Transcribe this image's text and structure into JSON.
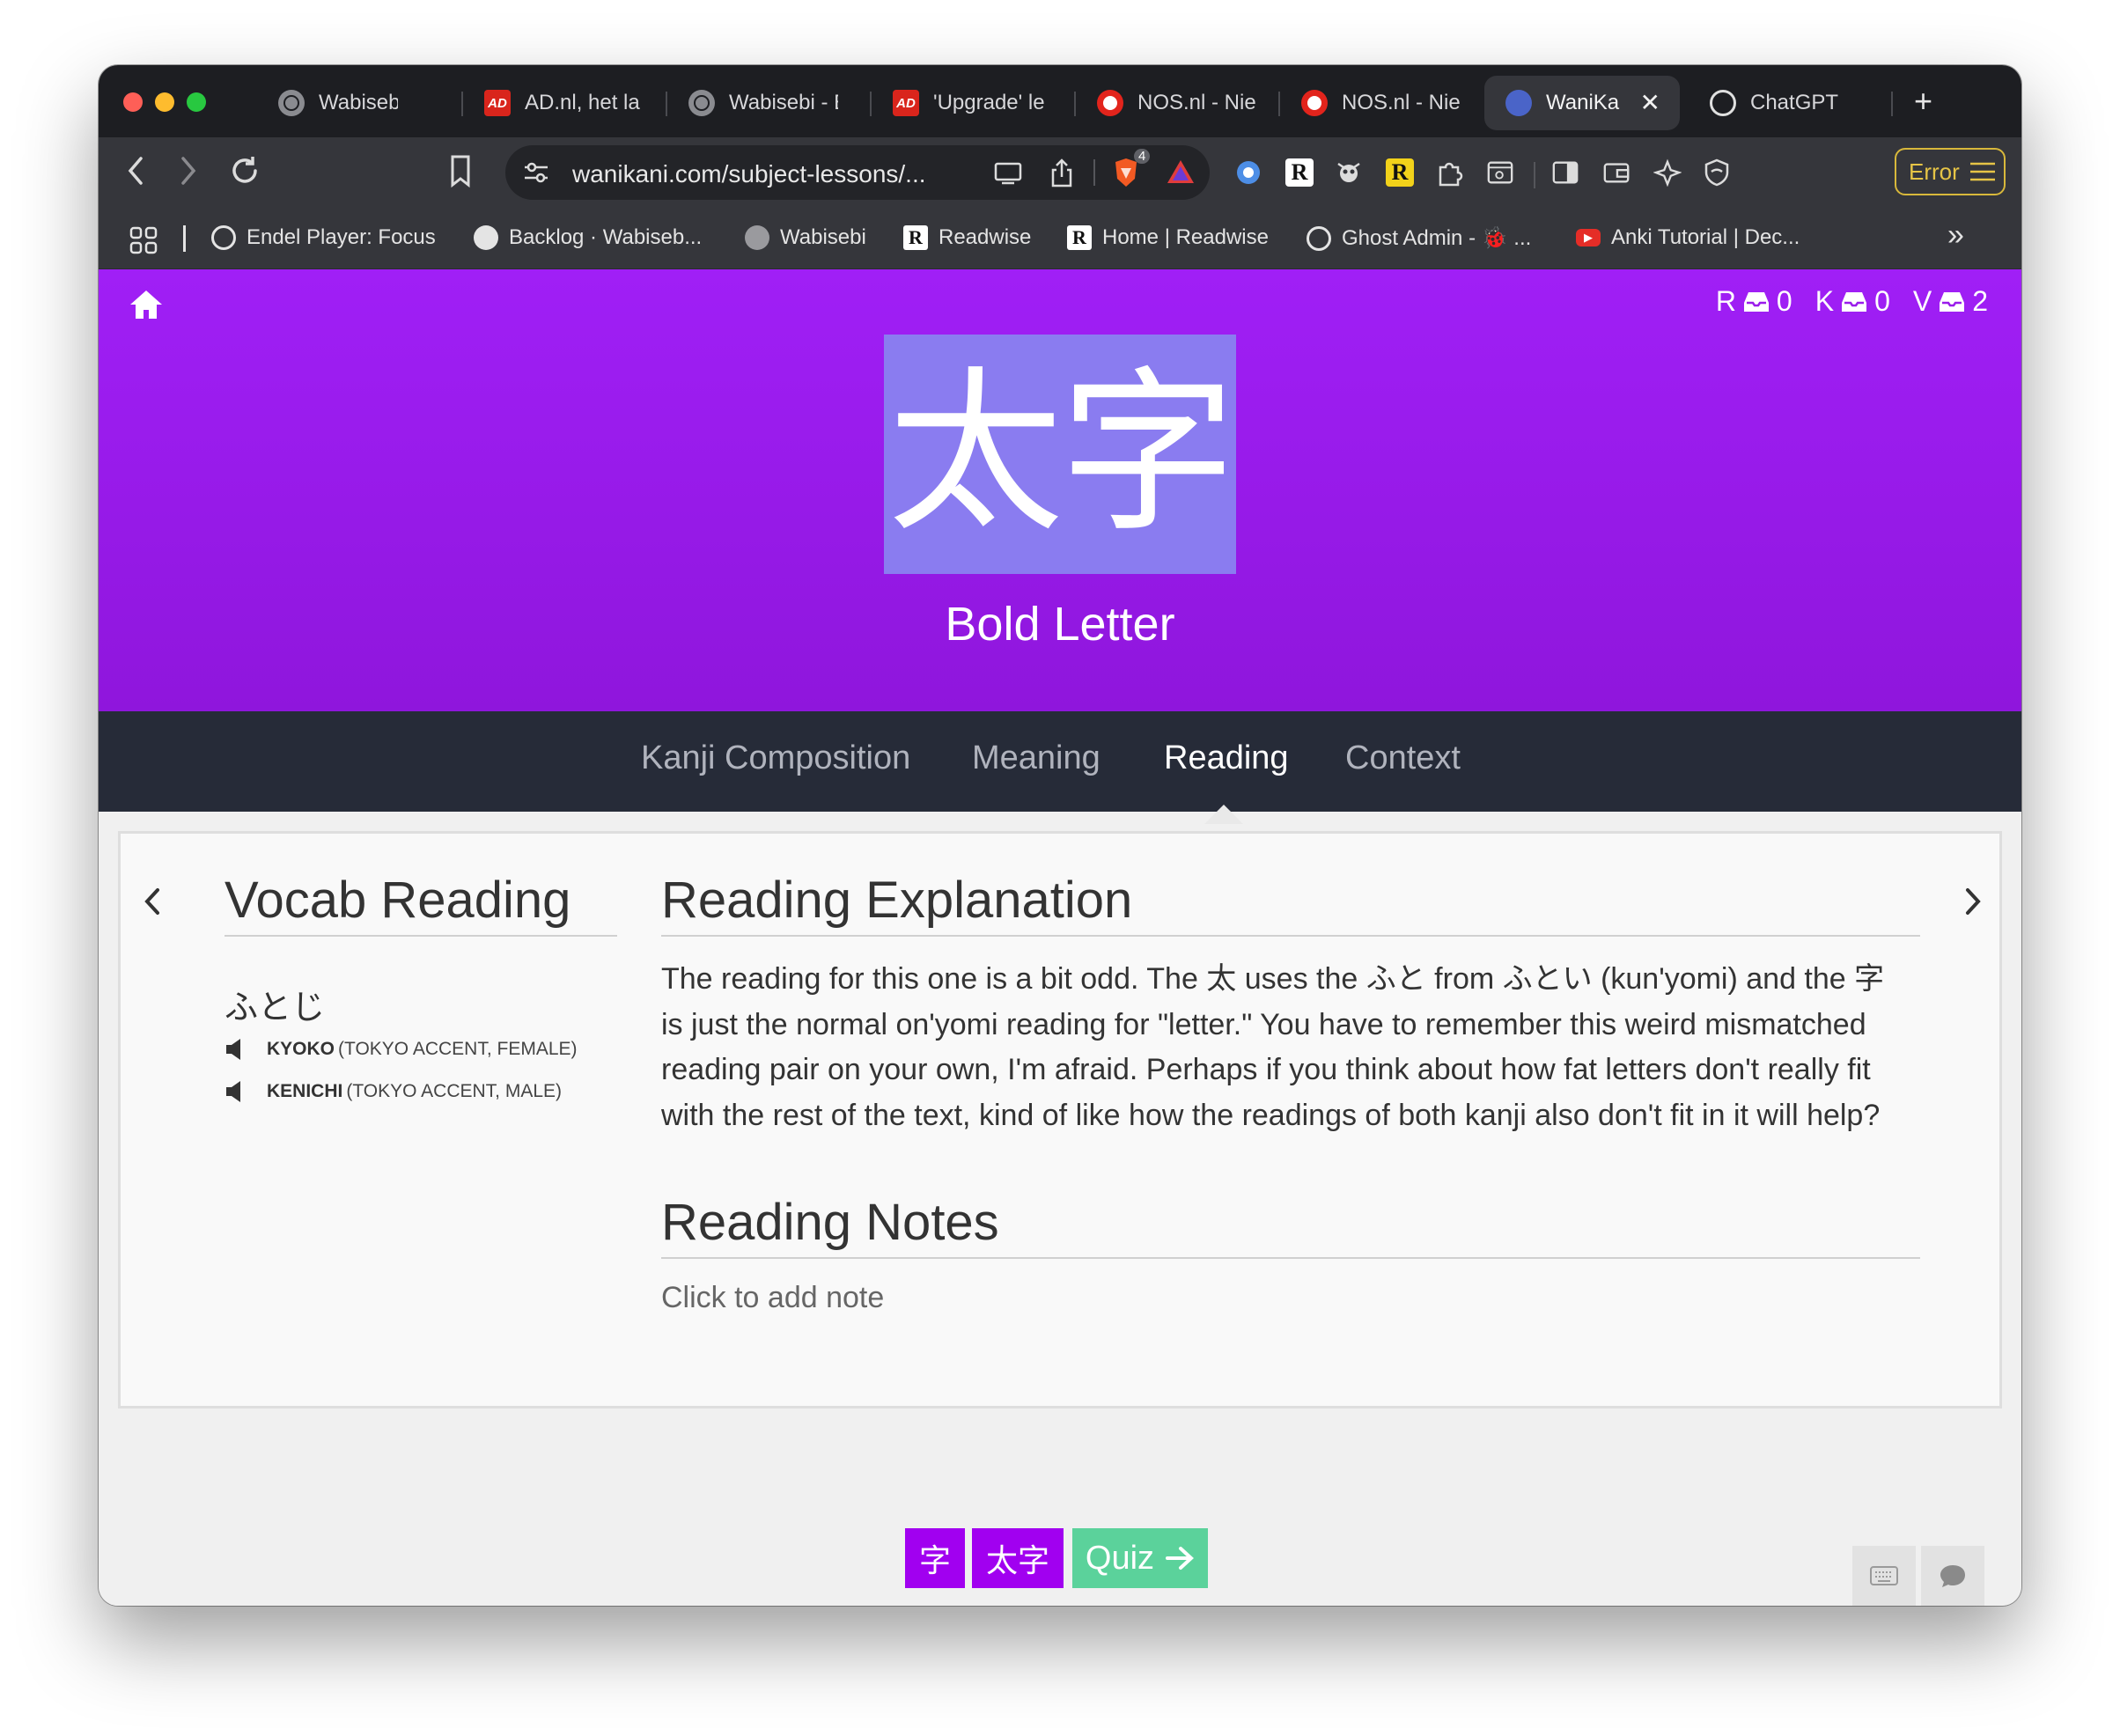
{
  "browser": {
    "tabs": [
      {
        "label": "Wabisebi - E",
        "icon": "globe-icon"
      },
      {
        "label": "AD.nl, het la",
        "icon": "ad-icon"
      },
      {
        "label": "Wabisebi - E",
        "icon": "globe-icon"
      },
      {
        "label": "'Upgrade' le",
        "icon": "ad-icon"
      },
      {
        "label": "NOS.nl - Nie",
        "icon": "nos-icon"
      },
      {
        "label": "NOS.nl - Nie",
        "icon": "nos-icon"
      },
      {
        "label": "WaniKa",
        "icon": "wanikani-icon",
        "active": true
      },
      {
        "label": "ChatGPT",
        "icon": "chatgpt-icon"
      }
    ],
    "ad_icon_text": "AD",
    "url": "wanikani.com/subject-lessons/...",
    "brave_badge": "4",
    "ext_letter": "R",
    "error_label": "Error",
    "bookmarks": [
      {
        "label": "Endel Player: Focus",
        "icon": "endel-icon"
      },
      {
        "label": "Backlog · Wabiseb...",
        "icon": "github-icon"
      },
      {
        "label": "Wabisebi",
        "icon": "globe-icon"
      },
      {
        "label": "Readwise",
        "icon": "readwise-icon"
      },
      {
        "label": "Home | Readwise",
        "icon": "readwise-icon"
      },
      {
        "label": "Ghost Admin - 🐞 ...",
        "icon": "ghost-icon"
      },
      {
        "label": "Anki Tutorial | Dec...",
        "icon": "youtube-icon"
      }
    ],
    "bookmark_letter": "R",
    "more_bookmarks": "»"
  },
  "header": {
    "queues": [
      {
        "letter": "R",
        "count": "0"
      },
      {
        "letter": "K",
        "count": "0"
      },
      {
        "letter": "V",
        "count": "2"
      }
    ],
    "characters": "太字",
    "meaning": "Bold Letter"
  },
  "tabs": [
    "Kanji Composition",
    "Meaning",
    "Reading",
    "Context"
  ],
  "active_tab": "Reading",
  "vocab_reading": {
    "heading": "Vocab Reading",
    "kana": "ふとじ",
    "audio": [
      {
        "name": "KYOKO",
        "desc": "(TOKYO ACCENT, FEMALE)"
      },
      {
        "name": "KENICHI",
        "desc": "(TOKYO ACCENT, MALE)"
      }
    ]
  },
  "reading_explanation": {
    "heading": "Reading Explanation",
    "text": "The reading for this one is a bit odd. The 太 uses the ふと from ふとい (kun'yomi) and the 字 is just the normal on'yomi reading for \"letter.\" You have to remember this weird mismatched reading pair on your own, I'm afraid. Perhaps if you think about how fat letters don't really fit with the rest of the text, kind of like how the readings of both kanji also don't fit in it will help?"
  },
  "reading_notes": {
    "heading": "Reading Notes",
    "placeholder": "Click to add note"
  },
  "lesson_items": [
    "字",
    "太字"
  ],
  "quiz_label": "Quiz",
  "colors": {
    "accent": "#a100f0",
    "hero_top": "#a01ff6",
    "char_box": "#8a7cf0",
    "quiz": "#5bd29b",
    "tab_bar": "#262b38"
  }
}
